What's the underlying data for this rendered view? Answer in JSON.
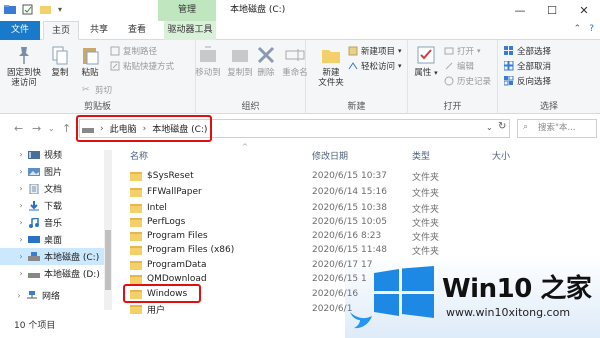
{
  "window": {
    "manage_tab": "管理",
    "title": "本地磁盘 (C:)",
    "min": "—",
    "max": "☐",
    "close": "✕"
  },
  "tabs": {
    "file": "文件",
    "home": "主页",
    "share": "共享",
    "view": "查看",
    "drive_tools": "驱动器工具"
  },
  "ribbon": {
    "clipboard": {
      "pin_label": "固定到快\n速访问",
      "copy": "复制",
      "paste": "粘贴",
      "copy_path": "复制路径",
      "paste_shortcut": "粘贴快捷方式",
      "cut": "剪切",
      "group": "剪贴板"
    },
    "organize": {
      "move_to": "移动到",
      "copy_to": "复制到",
      "delete": "删除",
      "rename": "重命名",
      "group": "组织"
    },
    "new": {
      "new_item": "新建项目",
      "easy_access": "轻松访问",
      "new_folder": "新建\n文件夹",
      "group": "新建"
    },
    "open": {
      "properties": "属性",
      "open": "打开",
      "edit": "编辑",
      "history": "历史记录",
      "group": "打开"
    },
    "select": {
      "select_all": "全部选择",
      "select_none": "全部取消",
      "invert": "反向选择",
      "group": "选择"
    }
  },
  "address": {
    "crumb1": "此电脑",
    "crumb2": "本地磁盘 (C:)",
    "search_placeholder": "搜索\"本..."
  },
  "sidebar": {
    "items": [
      {
        "label": "视频",
        "icon": "video-icon"
      },
      {
        "label": "图片",
        "icon": "pictures-icon"
      },
      {
        "label": "文档",
        "icon": "documents-icon"
      },
      {
        "label": "下载",
        "icon": "downloads-icon"
      },
      {
        "label": "音乐",
        "icon": "music-icon"
      },
      {
        "label": "桌面",
        "icon": "desktop-icon"
      },
      {
        "label": "本地磁盘 (C:)",
        "icon": "drive-icon"
      },
      {
        "label": "本地磁盘 (D:)",
        "icon": "drive-icon"
      },
      {
        "label": "网络",
        "icon": "network-icon"
      }
    ]
  },
  "columns": {
    "name": "名称",
    "date": "修改日期",
    "type": "类型",
    "size": "大小"
  },
  "files": [
    {
      "name": "$SysReset",
      "date": "2020/6/15 10:37",
      "type": "文件夹"
    },
    {
      "name": "FFWallPaper",
      "date": "2020/6/14 15:16",
      "type": "文件夹"
    },
    {
      "name": "Intel",
      "date": "2020/6/15 10:38",
      "type": "文件夹"
    },
    {
      "name": "PerfLogs",
      "date": "2020/6/15 10:05",
      "type": "文件夹"
    },
    {
      "name": "Program Files",
      "date": "2020/6/16 8:23",
      "type": "文件夹"
    },
    {
      "name": "Program Files (x86)",
      "date": "2020/6/15 11:48",
      "type": "文件夹"
    },
    {
      "name": "ProgramData",
      "date": "2020/6/17 17",
      "type": ""
    },
    {
      "name": "QMDownload",
      "date": "2020/6/15 1",
      "type": ""
    },
    {
      "name": "Windows",
      "date": "2020/6/16",
      "type": ""
    },
    {
      "name": "用户",
      "date": "2020/6/1",
      "type": ""
    }
  ],
  "status": {
    "count": "10 个项目"
  },
  "watermark": {
    "brand": "Win10 之家",
    "url": "www.win10xitong.com"
  },
  "colors": {
    "accent": "#1979ca",
    "manage": "#bfe6bf",
    "highlight": "#e01010",
    "folder": "#f3d06a"
  }
}
